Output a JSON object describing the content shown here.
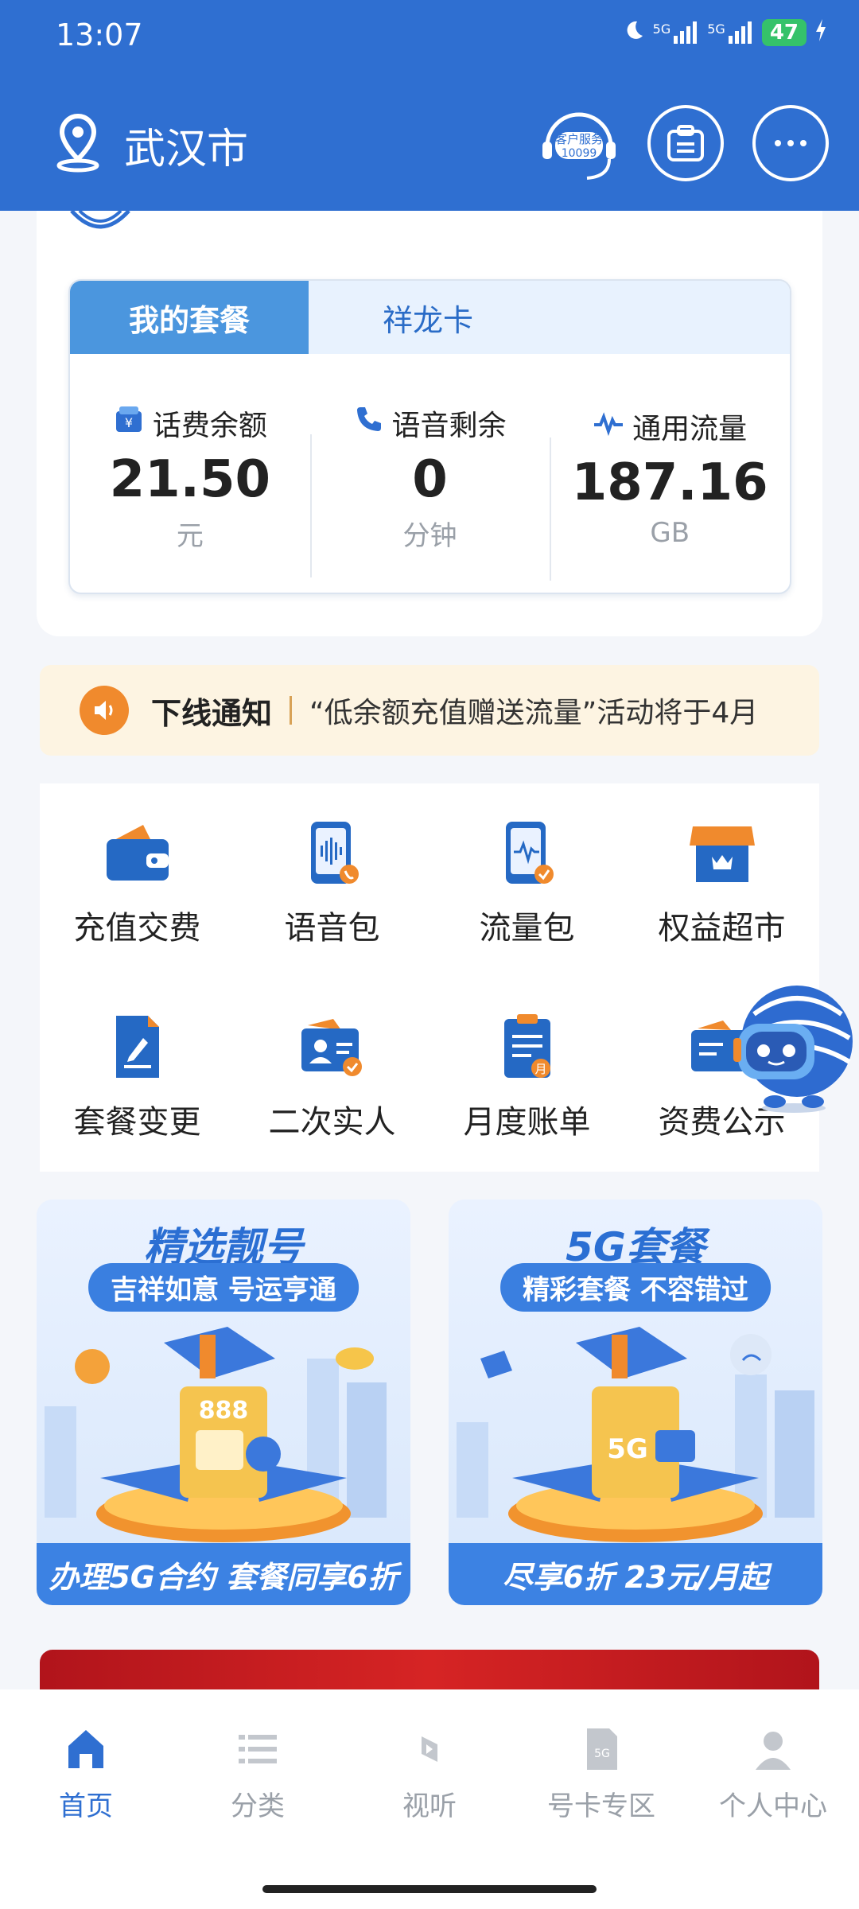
{
  "status_bar": {
    "time": "13:07",
    "signal1": "5G",
    "signal2": "5G",
    "battery": "47"
  },
  "header": {
    "city": "武汉市",
    "cs_line1": "客户服务",
    "cs_line2": "10099"
  },
  "package": {
    "tabs": [
      {
        "label": "我的套餐",
        "active": true
      },
      {
        "label": "祥龙卡",
        "active": false
      }
    ],
    "stats": [
      {
        "label": "话费余额",
        "value": "21.50",
        "unit": "元",
        "icon": "yuan-wallet-icon"
      },
      {
        "label": "语音剩余",
        "value": "0",
        "unit": "分钟",
        "icon": "phone-icon"
      },
      {
        "label": "通用流量",
        "value": "187.16",
        "unit": "GB",
        "icon": "pulse-icon"
      }
    ]
  },
  "notice": {
    "title": "下线通知",
    "text": "“低余额充值赠送流量”活动将于4月"
  },
  "services": [
    {
      "label": "充值交费",
      "icon": "wallet-icon"
    },
    {
      "label": "语音包",
      "icon": "voice-package-icon"
    },
    {
      "label": "流量包",
      "icon": "data-package-icon"
    },
    {
      "label": "权益超市",
      "icon": "store-icon"
    },
    {
      "label": "套餐变更",
      "icon": "plan-change-icon"
    },
    {
      "label": "二次实人",
      "icon": "id-verify-icon"
    },
    {
      "label": "月度账单",
      "icon": "monthly-bill-icon"
    },
    {
      "label": "资费公示",
      "icon": "tariff-notice-icon"
    }
  ],
  "promos": [
    {
      "title": "精选靓号",
      "subtitle": "吉祥如意 号运亨通",
      "card_text": "888",
      "footer": "办理5G合约 套餐同享6折"
    },
    {
      "title": "5G套餐",
      "subtitle": "精彩套餐 不容错过",
      "card_text": "5G",
      "footer": "尽享6折 23元/月起"
    }
  ],
  "bottom_nav": [
    {
      "label": "首页",
      "icon": "home-icon",
      "active": true
    },
    {
      "label": "分类",
      "icon": "list-icon",
      "active": false
    },
    {
      "label": "视听",
      "icon": "video-icon",
      "active": false
    },
    {
      "label": "号卡专区",
      "icon": "sim-card-icon",
      "active": false
    },
    {
      "label": "个人中心",
      "icon": "person-icon",
      "active": false
    }
  ],
  "colors": {
    "brand_blue": "#2f6fd1",
    "accent_orange": "#f08a2d",
    "tab_active": "#4b96de"
  }
}
